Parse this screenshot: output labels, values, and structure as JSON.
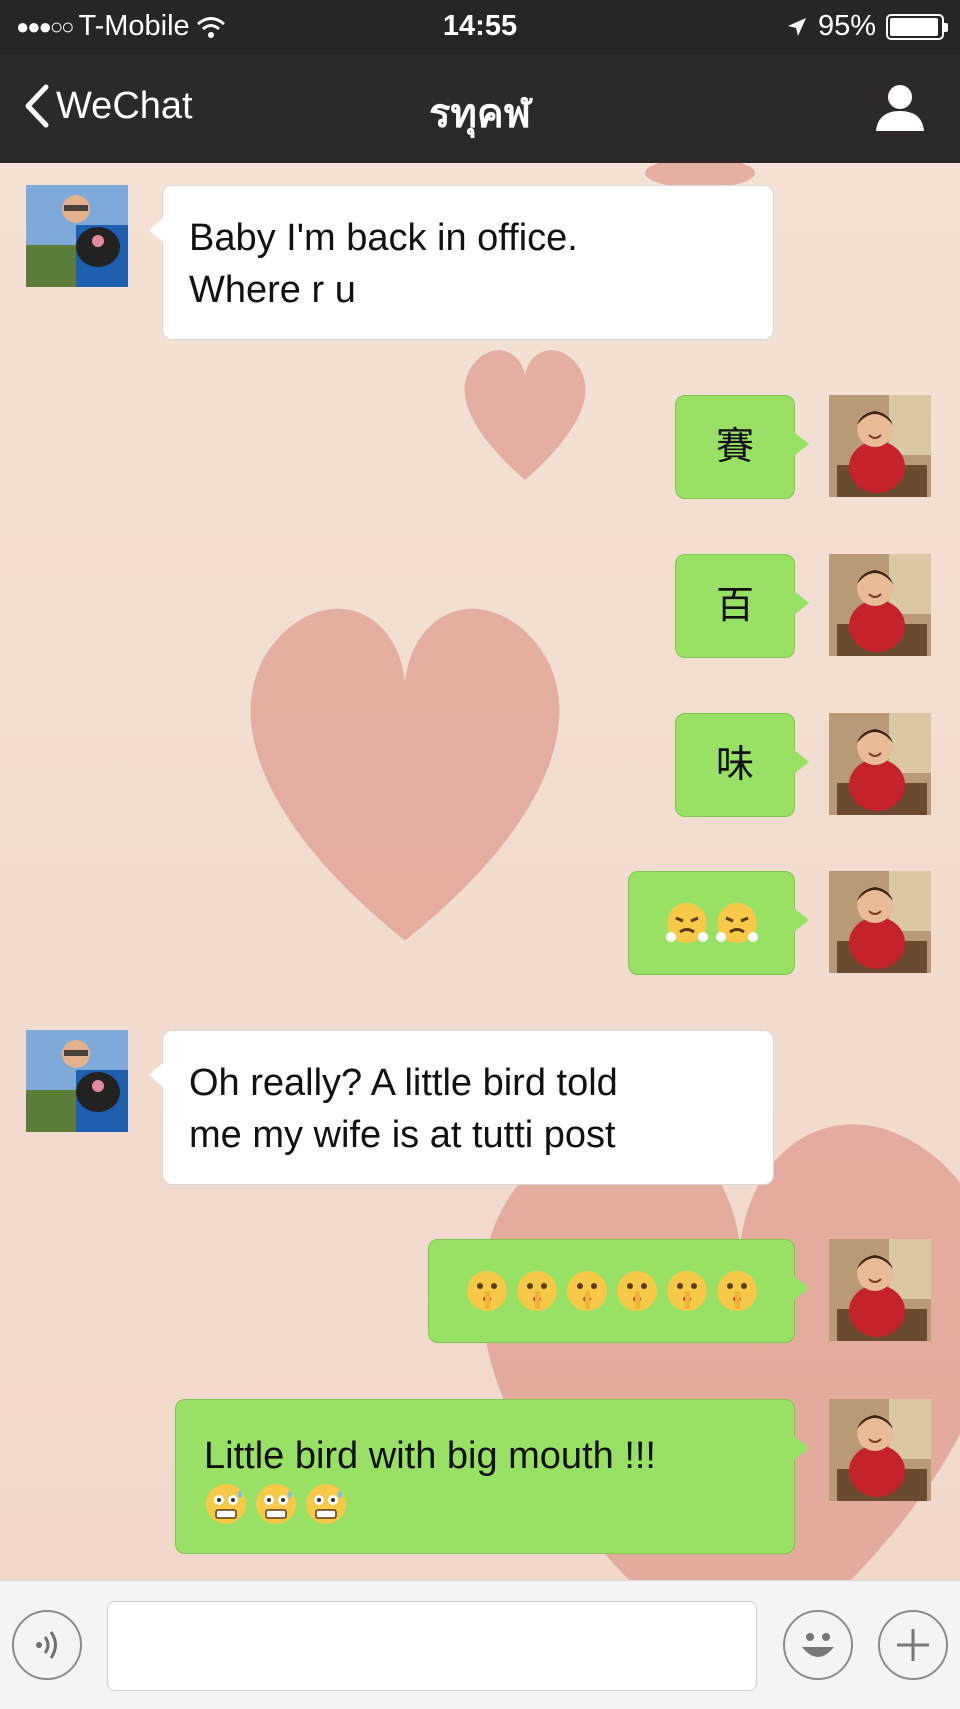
{
  "status_bar": {
    "carrier": "T-Mobile",
    "time": "14:55",
    "battery": "95%",
    "battery_level": 0.95
  },
  "nav": {
    "back_label": "WeChat",
    "title": "รทุคฬ"
  },
  "messages": [
    {
      "side": "in",
      "text_line1": "Baby I'm back in office.",
      "text_line2": "Where r u"
    },
    {
      "side": "out",
      "text": "賽"
    },
    {
      "side": "out",
      "text": "百"
    },
    {
      "side": "out",
      "text": "味"
    },
    {
      "side": "out",
      "emojis": [
        "angry-steam-emoji",
        "angry-steam-emoji"
      ]
    },
    {
      "side": "in",
      "text_line1": "Oh really? A little bird told",
      "text_line2": "me my wife is at tutti post"
    },
    {
      "side": "out",
      "emojis": [
        "shush-emoji",
        "shush-emoji",
        "shush-emoji",
        "shush-emoji",
        "shush-emoji",
        "shush-emoji"
      ]
    },
    {
      "side": "out",
      "text": "Little bird with big mouth !!!",
      "emojis": [
        "scared-sweat-emoji",
        "scared-sweat-emoji",
        "scared-sweat-emoji"
      ]
    }
  ],
  "input": {
    "value": "",
    "placeholder": ""
  },
  "icons": {
    "back": "chevron-left-icon",
    "profile": "person-icon",
    "voice": "voice-icon",
    "emoji": "smiley-icon",
    "more": "plus-icon"
  },
  "colors": {
    "nav_bg": "#2d2928",
    "outgoing_bubble": "#98e165",
    "incoming_bubble": "#ffffff",
    "chat_bg": "#f3dfd3"
  }
}
